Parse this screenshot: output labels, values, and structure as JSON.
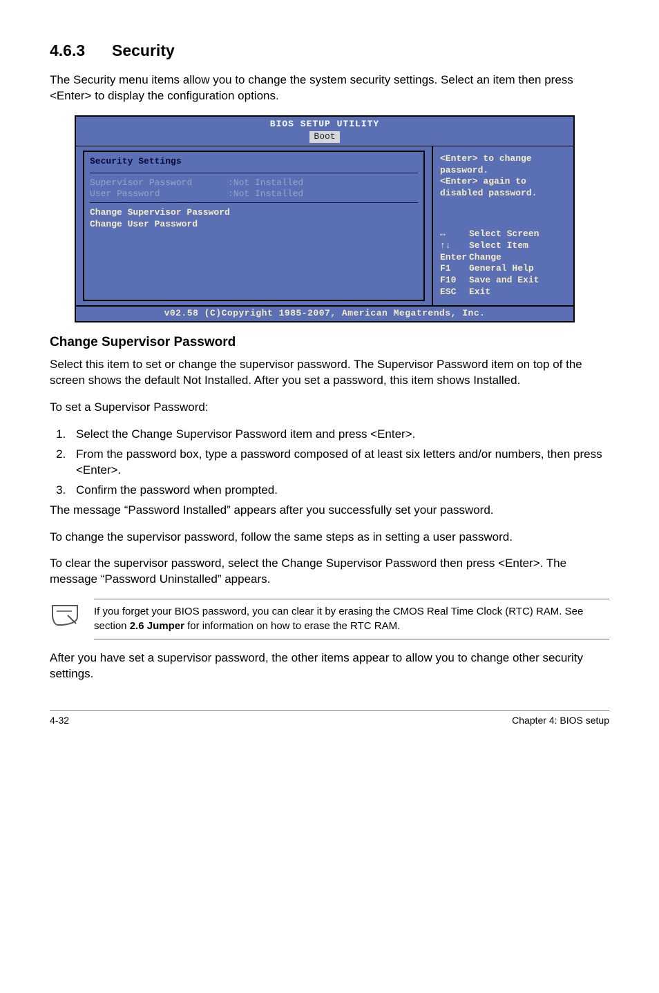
{
  "section": {
    "number": "4.6.3",
    "title": "Security"
  },
  "intro": "The Security menu items allow you to change the system security settings. Select an item then press <Enter> to display the configuration options.",
  "bios": {
    "header": "BIOS SETUP UTILITY",
    "tab": "Boot",
    "left": {
      "title": "Security Settings",
      "rows": [
        {
          "label": "Supervisor Password",
          "value": ":Not Installed"
        },
        {
          "label": "User Password",
          "value": ":Not Installed"
        }
      ],
      "options": [
        "Change Supervisor Password",
        "Change User Password"
      ]
    },
    "right": {
      "help": [
        "<Enter> to change",
        "password.",
        "<Enter> again to",
        "disabled password."
      ],
      "nav": [
        {
          "key": "↔",
          "label": "Select Screen"
        },
        {
          "key": "↑↓",
          "label": "Select Item"
        },
        {
          "key": "Enter",
          "label": "Change"
        },
        {
          "key": "F1",
          "label": "General Help"
        },
        {
          "key": "F10",
          "label": "Save and Exit"
        },
        {
          "key": "ESC",
          "label": "Exit"
        }
      ]
    },
    "footer": "v02.58 (C)Copyright 1985-2007, American Megatrends, Inc."
  },
  "subhead": "Change Supervisor Password",
  "p1": "Select this item to set or change the supervisor password. The Supervisor Password item on top of the screen shows the default Not Installed. After you set a password, this item shows Installed.",
  "p2": "To set a Supervisor Password:",
  "steps": [
    "Select the Change Supervisor Password item and press <Enter>.",
    "From the password box, type a password composed of at least six letters and/or numbers, then press <Enter>.",
    "Confirm the password when prompted."
  ],
  "p3": "The message “Password Installed” appears after you successfully set your password.",
  "p4": "To change the supervisor password, follow the same steps as in setting a user password.",
  "p5": "To clear the supervisor password, select the Change Supervisor Password then press <Enter>. The message “Password Uninstalled” appears.",
  "note": {
    "pre": "If you forget your BIOS password, you can clear it by erasing the CMOS Real Time Clock (RTC) RAM. See section ",
    "bold": "2.6 Jumper",
    "post": " for information on how to erase the RTC RAM."
  },
  "p6": "After you have set a supervisor password, the other items appear to allow you to change other security settings.",
  "footer": {
    "left": "4-32",
    "right": "Chapter 4: BIOS setup"
  }
}
